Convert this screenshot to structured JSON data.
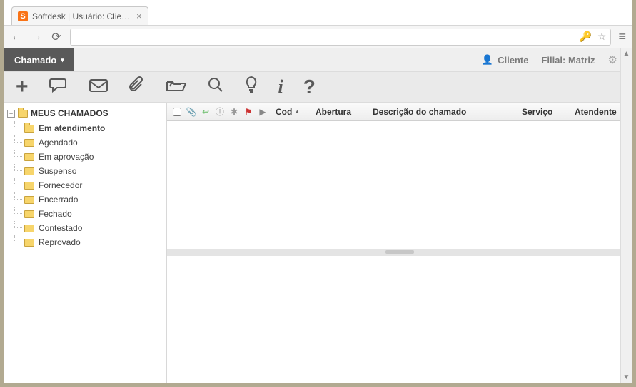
{
  "window": {
    "tab_title": "Softdesk | Usuário: Cliente"
  },
  "app": {
    "dropdown_label": "Chamado",
    "user_label": "Cliente",
    "filial_label": "Filial: Matriz"
  },
  "tree": {
    "root": "MEUS CHAMADOS",
    "items": [
      {
        "label": "Em atendimento",
        "bold": true
      },
      {
        "label": "Agendado"
      },
      {
        "label": "Em aprovação"
      },
      {
        "label": "Suspenso"
      },
      {
        "label": "Fornecedor"
      },
      {
        "label": "Encerrado"
      },
      {
        "label": "Fechado"
      },
      {
        "label": "Contestado"
      },
      {
        "label": "Reprovado"
      }
    ]
  },
  "grid": {
    "columns": {
      "cod": "Cod",
      "abertura": "Abertura",
      "descricao": "Descrição do chamado",
      "servico": "Serviço",
      "atendente": "Atendente"
    }
  }
}
